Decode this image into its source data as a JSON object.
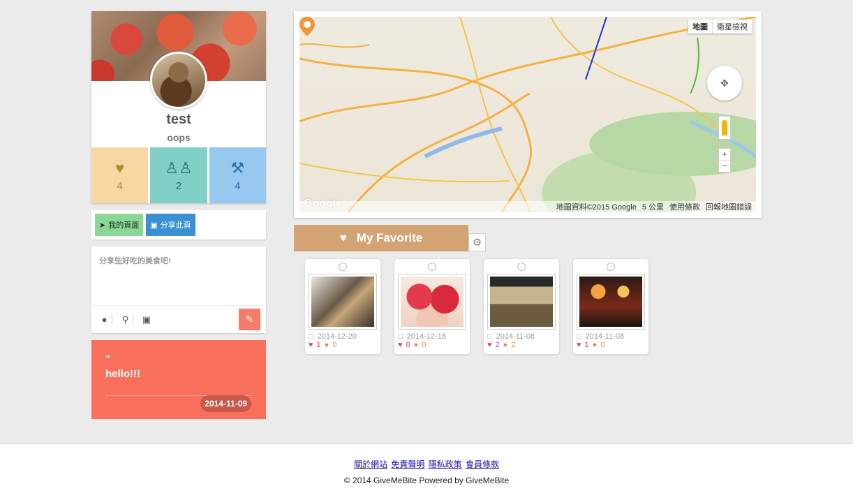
{
  "profile": {
    "name": "test",
    "subtitle": "oops",
    "stats": [
      {
        "icon": "heart-icon",
        "value": "4"
      },
      {
        "icon": "users-icon",
        "value": "2"
      },
      {
        "icon": "utensils-icon",
        "value": "4"
      }
    ]
  },
  "share": {
    "my_page": "我的頁面",
    "share_page": "分享此頁"
  },
  "post": {
    "placeholder": "分享些好吃的美食吧!"
  },
  "quote": {
    "text": "hello!!!",
    "date": "2014-11-09"
  },
  "map": {
    "type_map": "地圖",
    "type_satellite": "衛星檢視",
    "attribution": "地圖資料©2015 Google",
    "scale": "5 公里",
    "terms": "使用條款",
    "report": "回報地圖錯誤",
    "logo": "Google"
  },
  "favorite": {
    "title": "My Favorite",
    "items": [
      {
        "date": "2014-12-20",
        "likes": "1",
        "comments": "0"
      },
      {
        "date": "2014-12-18",
        "likes": "0",
        "comments": "0"
      },
      {
        "date": "2014-11-08",
        "likes": "2",
        "comments": "2"
      },
      {
        "date": "2014-11-08",
        "likes": "1",
        "comments": "0"
      }
    ]
  },
  "footer": {
    "links": [
      "關於網站",
      "免責聲明",
      "隱私政策",
      "會員條款"
    ],
    "copyright": "© 2014 GiveMeBite Powered by GiveMeBite"
  },
  "colors": {
    "accent": "#d4a373",
    "quote_bg": "#f8705c",
    "stat_likes": "#f9d7a3",
    "stat_friends": "#80d0c7",
    "stat_food": "#97c8ee"
  }
}
